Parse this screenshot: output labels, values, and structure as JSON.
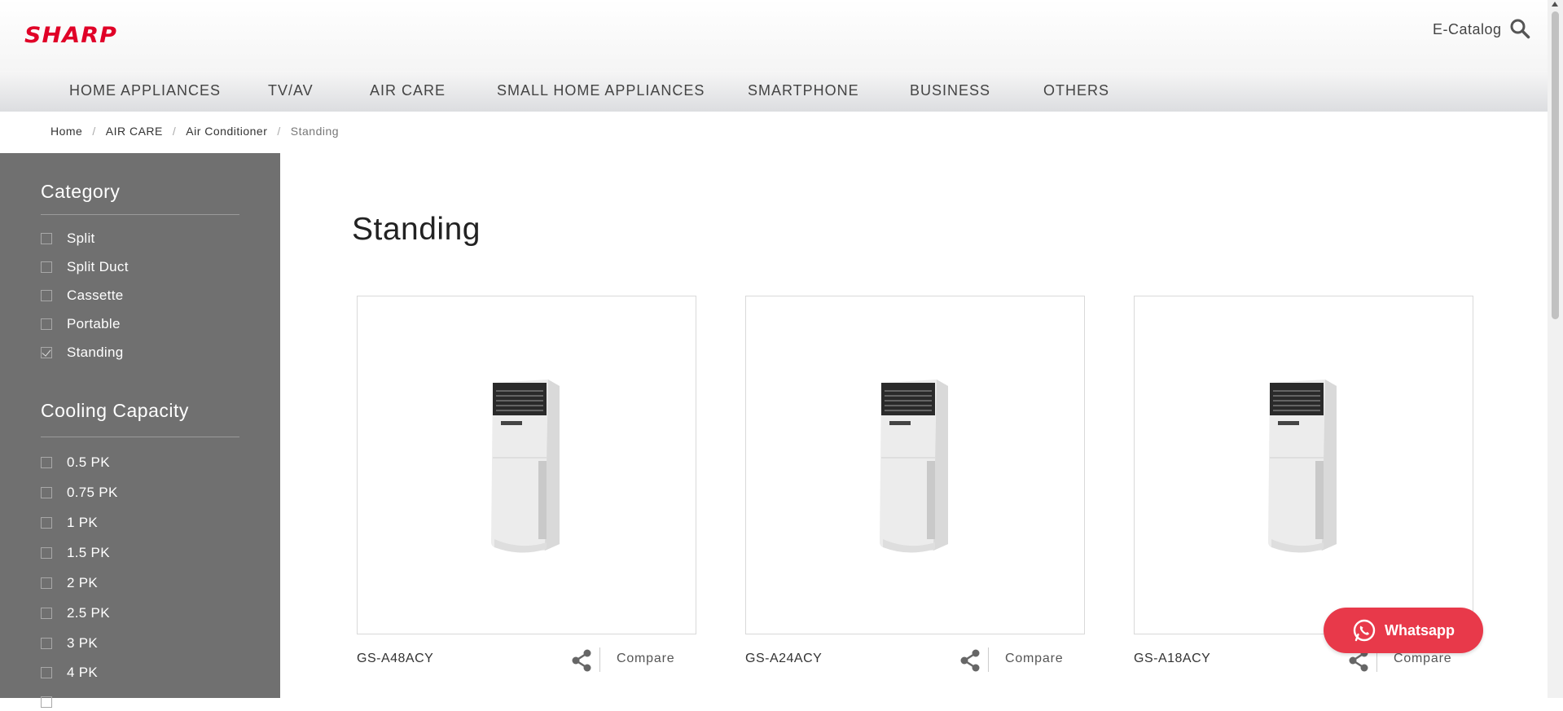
{
  "brand": "SHARP",
  "colors": {
    "brand_red": "#e00027",
    "sidebar_bg": "#707070",
    "whatsapp_bg": "#e8394a"
  },
  "header": {
    "ecatalog": "E-Catalog",
    "search_icon": "search-icon"
  },
  "nav": [
    "HOME APPLIANCES",
    "TV/AV",
    "AIR CARE",
    "SMALL HOME APPLIANCES",
    "SMARTPHONE",
    "BUSINESS",
    "OTHERS"
  ],
  "breadcrumb": [
    "Home",
    "AIR CARE",
    "Air Conditioner",
    "Standing"
  ],
  "sidebar": {
    "category_title": "Category",
    "categories": [
      {
        "label": "Split",
        "checked": false
      },
      {
        "label": "Split Duct",
        "checked": false
      },
      {
        "label": "Cassette",
        "checked": false
      },
      {
        "label": "Portable",
        "checked": false
      },
      {
        "label": "Standing",
        "checked": true
      }
    ],
    "capacity_title": "Cooling Capacity",
    "capacities": [
      {
        "label": "0.5 PK",
        "checked": false
      },
      {
        "label": "0.75 PK",
        "checked": false
      },
      {
        "label": "1 PK",
        "checked": false
      },
      {
        "label": "1.5 PK",
        "checked": false
      },
      {
        "label": "2 PK",
        "checked": false
      },
      {
        "label": "2.5 PK",
        "checked": false
      },
      {
        "label": "3 PK",
        "checked": false
      },
      {
        "label": "4 PK",
        "checked": false
      }
    ]
  },
  "main": {
    "title": "Standing",
    "products": [
      {
        "model": "GS-A48ACY",
        "compare": "Compare"
      },
      {
        "model": "GS-A24ACY",
        "compare": "Compare"
      },
      {
        "model": "GS-A18ACY",
        "compare": "Compare"
      }
    ]
  },
  "whatsapp": {
    "label": "Whatsapp"
  }
}
